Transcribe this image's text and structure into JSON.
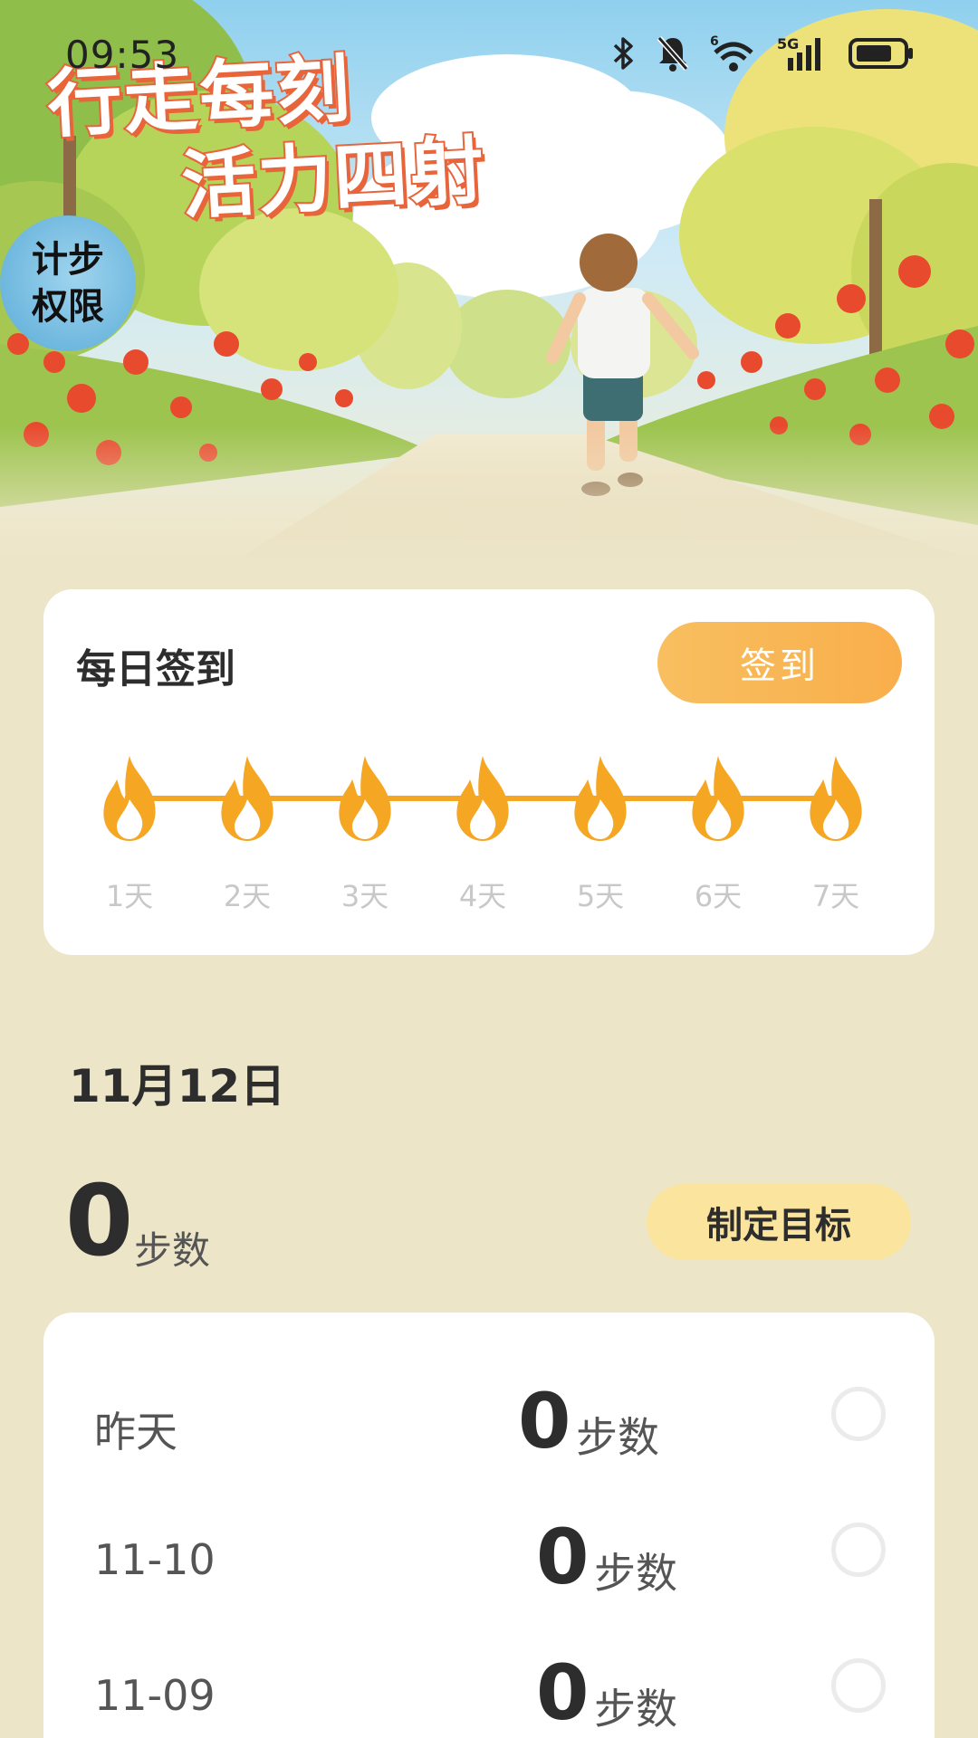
{
  "status_bar": {
    "time": "09:53",
    "icons": [
      "bluetooth-icon",
      "bell-muted-icon",
      "wifi-icon",
      "cellular-5g-icon",
      "battery-icon"
    ],
    "network_label": "5G",
    "wifi_label": "6"
  },
  "hero": {
    "slogan_line1": "行走每刻",
    "slogan_line2": "活力四射",
    "permission_badge_line1": "计步",
    "permission_badge_line2": "权限"
  },
  "checkin": {
    "title": "每日签到",
    "button_label": "签到",
    "days": [
      {
        "label": "1天"
      },
      {
        "label": "2天"
      },
      {
        "label": "3天"
      },
      {
        "label": "4天"
      },
      {
        "label": "5天"
      },
      {
        "label": "6天"
      },
      {
        "label": "7天"
      }
    ]
  },
  "today": {
    "date": "11月12日",
    "steps": "0",
    "unit": "步数",
    "goal_button": "制定目标"
  },
  "history": [
    {
      "date": "昨天",
      "steps": "0",
      "unit": "步数"
    },
    {
      "date": "11-10",
      "steps": "0",
      "unit": "步数"
    },
    {
      "date": "11-09",
      "steps": "0",
      "unit": "步数"
    }
  ],
  "colors": {
    "background": "#EDE5C8",
    "accent_orange": "#F5A623",
    "checkin_button": "#F9B452",
    "goal_button": "#FBE49E",
    "slogan_stroke": "#E8643A"
  }
}
